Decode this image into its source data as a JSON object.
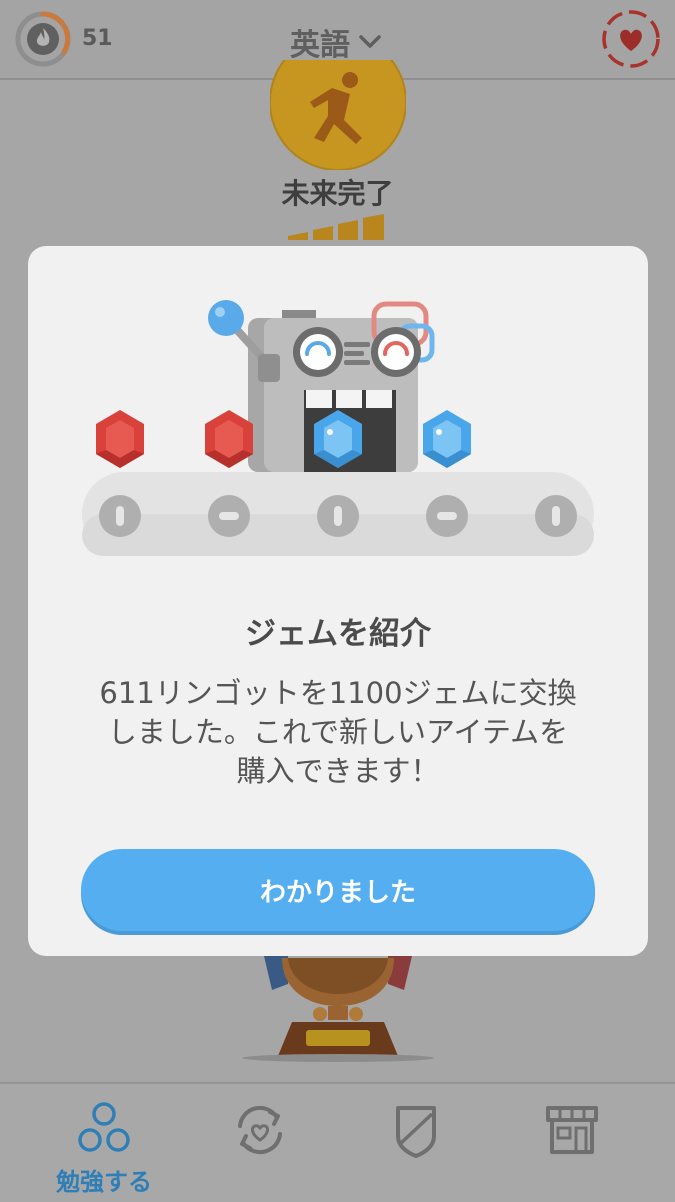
{
  "header": {
    "streak_count": "51",
    "language": "英語",
    "icons": {
      "streak": "flame-icon",
      "language_dropdown": "chevron-down-icon",
      "hearts": "heart-icon"
    }
  },
  "skill": {
    "title": "未来完了",
    "icon": "running-person-icon"
  },
  "modal": {
    "title": "ジェムを紹介",
    "body_lines": [
      "611リンゴットを1100ジェムに交換",
      "しました。これで新しいアイテムを",
      "購入できます！"
    ],
    "button_label": "わかりました",
    "illustration": "gem-exchange-machine"
  },
  "tabs": [
    {
      "label": "勉強する",
      "icon": "circles-icon",
      "active": true
    },
    {
      "label": "",
      "icon": "practice-heart-icon",
      "active": false
    },
    {
      "label": "",
      "icon": "shield-icon",
      "active": false
    },
    {
      "label": "",
      "icon": "shop-icon",
      "active": false
    }
  ],
  "colors": {
    "accent_blue": "#55aef0",
    "ruby_red": "#d9413b",
    "sapphire_blue": "#5cb8f0",
    "overlay_gray": "#a6a6a6"
  }
}
